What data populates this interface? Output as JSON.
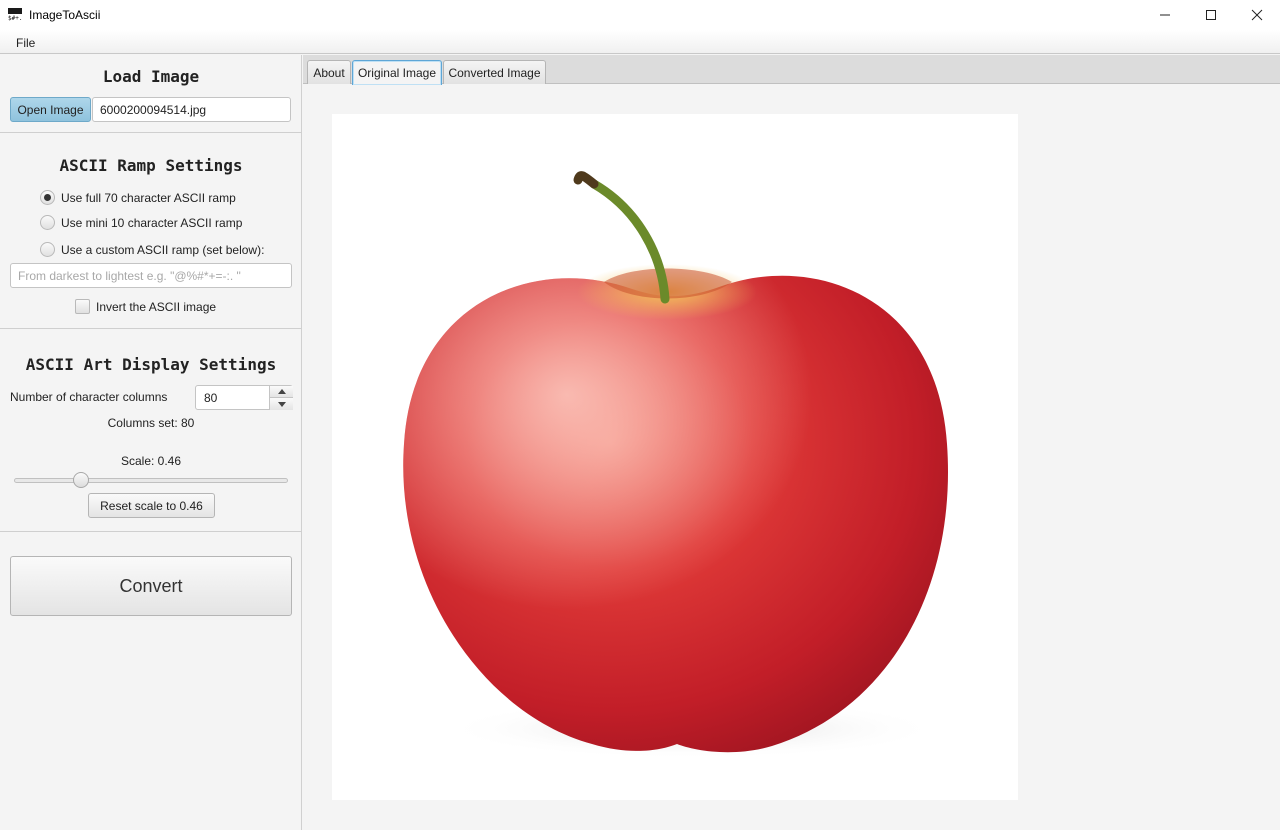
{
  "window": {
    "title": "ImageToAscii",
    "icon": "ascii-app-icon",
    "controls": [
      "minimize-icon",
      "maximize-icon",
      "close-icon"
    ]
  },
  "menu": {
    "items": [
      "File"
    ]
  },
  "load_image": {
    "title": "Load Image",
    "open_button": "Open Image",
    "file_name": "6000200094514.jpg"
  },
  "ramp_settings": {
    "title": "ASCII Ramp Settings",
    "options": [
      {
        "label": "Use full 70 character ASCII ramp",
        "selected": true
      },
      {
        "label": "Use mini 10 character ASCII ramp",
        "selected": false
      },
      {
        "label": "Use a custom ASCII ramp (set below):",
        "selected": false
      }
    ],
    "custom_placeholder": "From darkest to lightest e.g. \"@%#*+=-:. \"",
    "invert_label": "Invert the ASCII image",
    "invert_checked": false
  },
  "display_settings": {
    "title": "ASCII Art Display Settings",
    "columns_label": "Number of character columns",
    "columns_value": "80",
    "columns_set_text": "Columns set: 80",
    "scale_text": "Scale: 0.46",
    "scale_value": 0.46,
    "reset_button": "Reset scale to 0.46"
  },
  "convert_button": "Convert",
  "tabs": [
    {
      "label": "About",
      "active": false
    },
    {
      "label": "Original Image",
      "active": true
    },
    {
      "label": "Converted Image",
      "active": false
    }
  ],
  "preview": {
    "subject": "red-apple-photo"
  },
  "colors": {
    "accent": "#5ea6d6",
    "open_button": "#9fcde4",
    "apple_red": "#d9262c"
  }
}
